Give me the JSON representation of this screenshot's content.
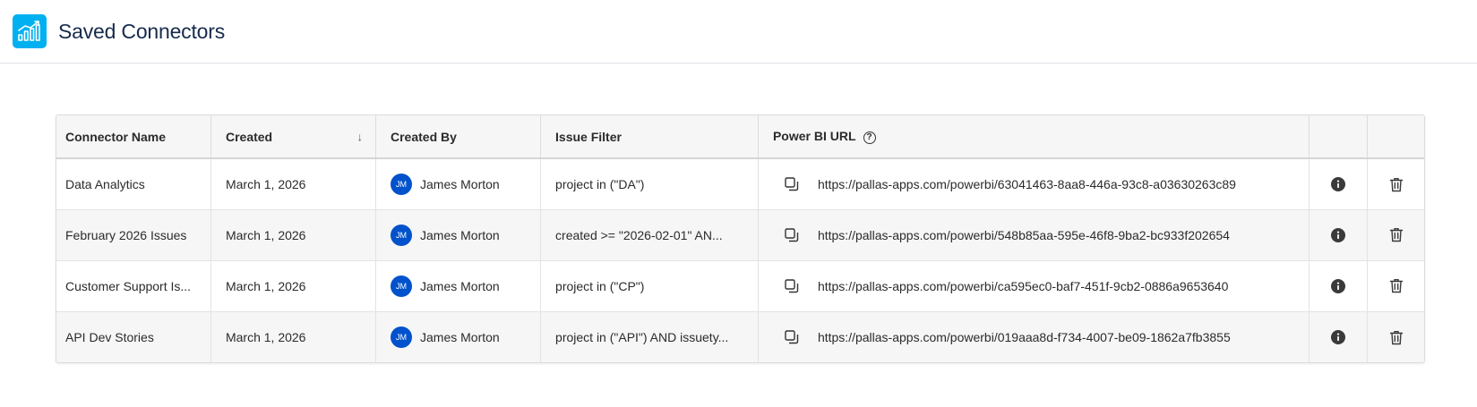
{
  "header": {
    "title": "Saved Connectors",
    "logo_icon": "chart-icon",
    "accent": "#00b0f0"
  },
  "table": {
    "columns": {
      "name": "Connector Name",
      "created": "Created",
      "created_by": "Created By",
      "filter": "Issue Filter",
      "url": "Power BI URL"
    },
    "sort_indicator": "↓",
    "rows": [
      {
        "name": "Data Analytics",
        "created": "March 1, 2026",
        "initials": "JM",
        "created_by": "James Morton",
        "filter": "project in (\"DA\")",
        "url": "https://pallas-apps.com/powerbi/63041463-8aa8-446a-93c8-a03630263c89"
      },
      {
        "name": "February 2026 Issues",
        "created": "March 1, 2026",
        "initials": "JM",
        "created_by": "James Morton",
        "filter": "created >= \"2026-02-01\" AN...",
        "url": "https://pallas-apps.com/powerbi/548b85aa-595e-46f8-9ba2-bc933f202654"
      },
      {
        "name": "Customer Support Is...",
        "created": "March 1, 2026",
        "initials": "JM",
        "created_by": "James Morton",
        "filter": "project in (\"CP\")",
        "url": "https://pallas-apps.com/powerbi/ca595ec0-baf7-451f-9cb2-0886a9653640"
      },
      {
        "name": "API Dev Stories",
        "created": "March 1, 2026",
        "initials": "JM",
        "created_by": "James Morton",
        "filter": "project in (\"API\") AND issuety...",
        "url": "https://pallas-apps.com/powerbi/019aaa8d-f734-4007-be09-1862a7fb3855"
      }
    ]
  }
}
